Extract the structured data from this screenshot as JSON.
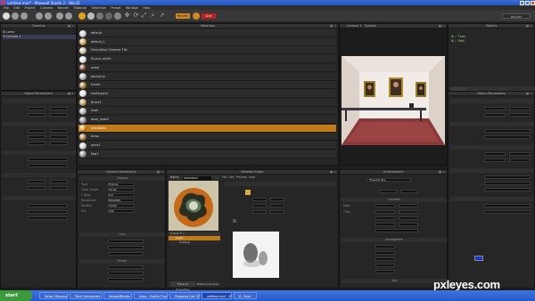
{
  "window": {
    "title": "untitled.mxs* - Maxwell Studio 2 - Win32"
  },
  "menu": [
    "File",
    "Edit",
    "Project",
    "Camera",
    "Render",
    "Material",
    "Selection",
    "Preset",
    "Window",
    "Help"
  ],
  "toolbar": {
    "render_label": "Render",
    "preview_label": "Live",
    "dropdown_value": "Render"
  },
  "panels": {
    "camera": "Cameras",
    "materials": "Materials",
    "render": "Camera 1",
    "options": "Options",
    "objects": "Objects",
    "object_params": "Object Parameters",
    "camera_params": "Camera Parameters",
    "render_options": "Render Options",
    "material_editor": "Material Editor",
    "environment": "Environment"
  },
  "scene_tree": [
    "Lamp",
    "Camera 1"
  ],
  "object_tree": [
    "Floor",
    "Wall"
  ],
  "materials_list": [
    {
      "name": "default",
      "color": "#c8c8c8"
    },
    {
      "name": "default_1",
      "color": "#c79a4a"
    },
    {
      "name": "Decorative Ceramic Tile",
      "color": "#c3b79b"
    },
    {
      "name": "Stucco_white",
      "color": "#dcdcdc"
    },
    {
      "name": "wood",
      "color": "#6b3a1e"
    },
    {
      "name": "backdrop",
      "color": "#b0b0b0"
    },
    {
      "name": "frame",
      "color": "#9a7a30"
    },
    {
      "name": "worldspace",
      "color": "#dcdcdc"
    },
    {
      "name": "Brass3",
      "color": "#b89850"
    },
    {
      "name": "hook",
      "color": "#aaaaaa"
    },
    {
      "name": "base_metal",
      "color": "#888888"
    },
    {
      "name": "Interlaken",
      "color": "#c9902a"
    },
    {
      "name": "brass",
      "color": "#a07030"
    },
    {
      "name": "pane1",
      "color": "#cccccc"
    },
    {
      "name": "Mat1",
      "color": "#8a8a8a"
    }
  ],
  "selected_material": "Interlaken",
  "material_editor": {
    "name_label": "Name",
    "name_value": "Interlaken",
    "tabs": [
      "Material Properties",
      "Material Preview"
    ],
    "layers": [
      "Layer",
      "Coating"
    ],
    "menu": [
      "File",
      "Edit",
      "Preview",
      "Help"
    ]
  },
  "camera_params": {
    "sections": [
      "Camera",
      "Lens",
      "Sensor"
    ],
    "fields": [
      {
        "label": "Type",
        "value": "Pinhole"
      },
      {
        "label": "Focal length",
        "value": "35.00"
      },
      {
        "label": "F-Stop",
        "value": "5.6"
      },
      {
        "label": "Resolution",
        "value": "800x600"
      },
      {
        "label": "Shutter",
        "value": "1/250"
      },
      {
        "label": "ISO",
        "value": "100"
      }
    ]
  },
  "environment": {
    "type": "Physical Sky",
    "location_label": "Location",
    "date_label": "Date",
    "time_label": "Time",
    "atmosphere_label": "Atmosphere",
    "sun_label": "Sun",
    "color_hex": "#1e36c8"
  },
  "render_view": {
    "wall": "#f0e8e0",
    "floor": "#9c4848"
  },
  "taskbar": {
    "start": "start",
    "items": [
      "Yahoo! Messenger",
      "Total Commander 7.5",
      "MaxwellRender - Win...",
      "Inbox - Mozilla Thunderbird",
      "Shopping Cart 3D Contest",
      "untitled.mxs* - Maxw...",
      "6 - Paint"
    ],
    "active": 5
  },
  "watermark": "pxleyes.com"
}
